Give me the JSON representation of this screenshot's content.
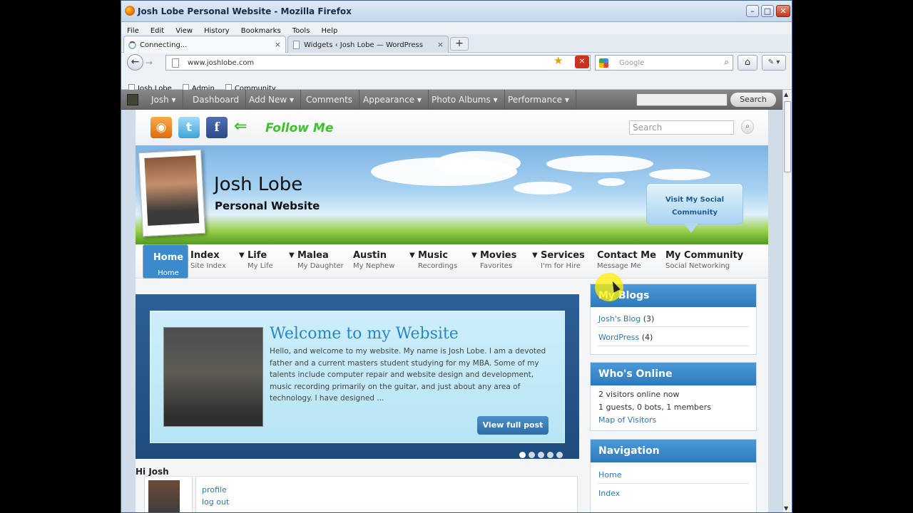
{
  "window": {
    "title": "Josh Lobe Personal Website - Mozilla Firefox",
    "min": "–",
    "max": "□",
    "close": "✕"
  },
  "menu": [
    "File",
    "Edit",
    "View",
    "History",
    "Bookmarks",
    "Tools",
    "Help"
  ],
  "tabs": [
    {
      "label": "Connecting...",
      "close": "×"
    },
    {
      "label": "Widgets ‹ Josh Lobe — WordPress",
      "close": "×"
    }
  ],
  "newtab": "+",
  "nav": {
    "back": "←",
    "forward": "→",
    "url": "www.joshlobe.com",
    "star": "★",
    "stop": "✕",
    "search_placeholder": "Google",
    "home": "⌂",
    "addon": "✎ ▾"
  },
  "bookmarks": [
    "Josh Lobe",
    "Admin",
    "Community"
  ],
  "adminbar": {
    "user": "Josh ▾",
    "items": [
      "Dashboard",
      "Add New ▾",
      "Comments",
      "Appearance ▾",
      "Photo Albums ▾",
      "Performance ▾"
    ],
    "search_button": "Search"
  },
  "social": {
    "rss": "◉",
    "twitter": "t",
    "facebook": "f",
    "arrow": "⇐",
    "follow": "Follow Me",
    "search_placeholder": "Search",
    "search_icon": "⌕"
  },
  "banner": {
    "name": "Josh Lobe",
    "subtitle": "Personal Website",
    "bubble_line1": "Visit My Social",
    "bubble_line2": "Community"
  },
  "mainnav": [
    {
      "title": "Home",
      "sub": "Home"
    },
    {
      "title": "Index",
      "sub": "Site Index"
    },
    {
      "title": "Life",
      "sub": "My Life"
    },
    {
      "title": "Malea",
      "sub": "My Daughter"
    },
    {
      "title": "Austin",
      "sub": "My Nephew"
    },
    {
      "title": "Music",
      "sub": "Recordings"
    },
    {
      "title": "Movies",
      "sub": "Favorites"
    },
    {
      "title": "Services",
      "sub": "I'm for Hire"
    },
    {
      "title": "Contact Me",
      "sub": "Message Me"
    },
    {
      "title": "My Community",
      "sub": "Social Networking"
    }
  ],
  "slide": {
    "title": "Welcome to my Website",
    "text": "Hello, and welcome to my website. My name is Josh Lobe. I am a devoted father and a current masters student studying for my MBA. Some of my talents include computer repair and website design and development, music recording primarily on the guitar, and just about any area of technology.     I have designed ...",
    "button": "View full post",
    "slides_total": 5,
    "slide_active": 1
  },
  "greeting": "Hi Josh",
  "userlinks": [
    "profile",
    "log out"
  ],
  "widgets": {
    "blogs": {
      "title": "My Blogs",
      "items": [
        {
          "name": "Josh's Blog",
          "count": "(3)"
        },
        {
          "name": "WordPress",
          "count": "(4)"
        }
      ]
    },
    "online": {
      "title": "Who's Online",
      "line1": "2 visitors online now",
      "line2": "1 guests, 0 bots, 1 members",
      "link": "Map of Visitors"
    },
    "navigation": {
      "title": "Navigation",
      "items": [
        "Home",
        "Index"
      ]
    }
  }
}
